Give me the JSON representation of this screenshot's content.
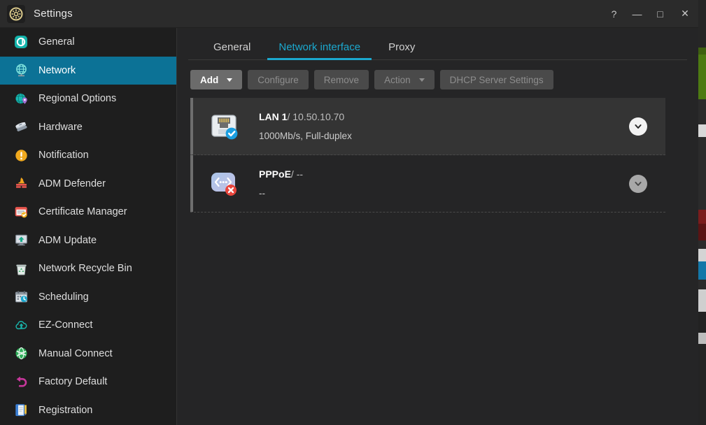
{
  "window": {
    "title": "Settings",
    "app_icon": "gear-icon",
    "controls": [
      {
        "name": "help-button",
        "glyph": "?"
      },
      {
        "name": "minimize-button",
        "glyph": "—"
      },
      {
        "name": "maximize-button",
        "glyph": "□"
      },
      {
        "name": "close-button",
        "glyph": "✕"
      }
    ]
  },
  "colors": {
    "accent_selected": "#0c7296",
    "accent_tab": "#1ba8ce",
    "window_bg": "#252526",
    "sidebar_bg": "#1e1e1e",
    "titlebar_bg": "#2b2b2b",
    "status_ok": "#1a9ee0",
    "status_error": "#e8453c"
  },
  "sidebar": {
    "items": [
      {
        "label": "General",
        "icon": "asustor-logo-icon",
        "active": false
      },
      {
        "label": "Network",
        "icon": "globe-icon",
        "active": true
      },
      {
        "label": "Regional Options",
        "icon": "globe-pin-icon",
        "active": false
      },
      {
        "label": "Hardware",
        "icon": "hardware-stack-icon",
        "active": false
      },
      {
        "label": "Notification",
        "icon": "exclamation-circle-icon",
        "active": false
      },
      {
        "label": "ADM Defender",
        "icon": "firewall-icon",
        "active": false
      },
      {
        "label": "Certificate Manager",
        "icon": "certificate-icon",
        "active": false
      },
      {
        "label": "ADM Update",
        "icon": "monitor-upload-icon",
        "active": false
      },
      {
        "label": "Network Recycle Bin",
        "icon": "recycle-bin-icon",
        "active": false
      },
      {
        "label": "Scheduling",
        "icon": "calendar-clock-icon",
        "active": false
      },
      {
        "label": "EZ-Connect",
        "icon": "cloud-upload-icon",
        "active": false
      },
      {
        "label": "Manual Connect",
        "icon": "globe-green-icon",
        "active": false
      },
      {
        "label": "Factory Default",
        "icon": "undo-arrow-icon",
        "active": false
      },
      {
        "label": "Registration",
        "icon": "notebook-pencil-icon",
        "active": false
      }
    ]
  },
  "main": {
    "tabs": [
      {
        "label": "General",
        "active": false
      },
      {
        "label": "Network interface",
        "active": true
      },
      {
        "label": "Proxy",
        "active": false
      }
    ],
    "toolbar": [
      {
        "label": "Add",
        "enabled": true,
        "has_chevron": true,
        "name": "add-button"
      },
      {
        "label": "Configure",
        "enabled": false,
        "has_chevron": false,
        "name": "configure-button"
      },
      {
        "label": "Remove",
        "enabled": false,
        "has_chevron": false,
        "name": "remove-button"
      },
      {
        "label": "Action",
        "enabled": false,
        "has_chevron": true,
        "name": "action-button"
      },
      {
        "label": "DHCP Server Settings",
        "enabled": false,
        "has_chevron": false,
        "name": "dhcp-server-settings-button"
      }
    ],
    "interfaces": [
      {
        "name": "LAN 1",
        "separator": "/",
        "address": "10.50.10.70",
        "details": "1000Mb/s, Full-duplex",
        "icon": "ethernet-port-icon",
        "status": "connected",
        "selected": true,
        "expand_hovered": true
      },
      {
        "name": "PPPoE",
        "separator": "/",
        "address": "--",
        "details": "--",
        "icon": "pppoe-icon",
        "status": "disconnected",
        "selected": false,
        "expand_hovered": false
      }
    ]
  }
}
